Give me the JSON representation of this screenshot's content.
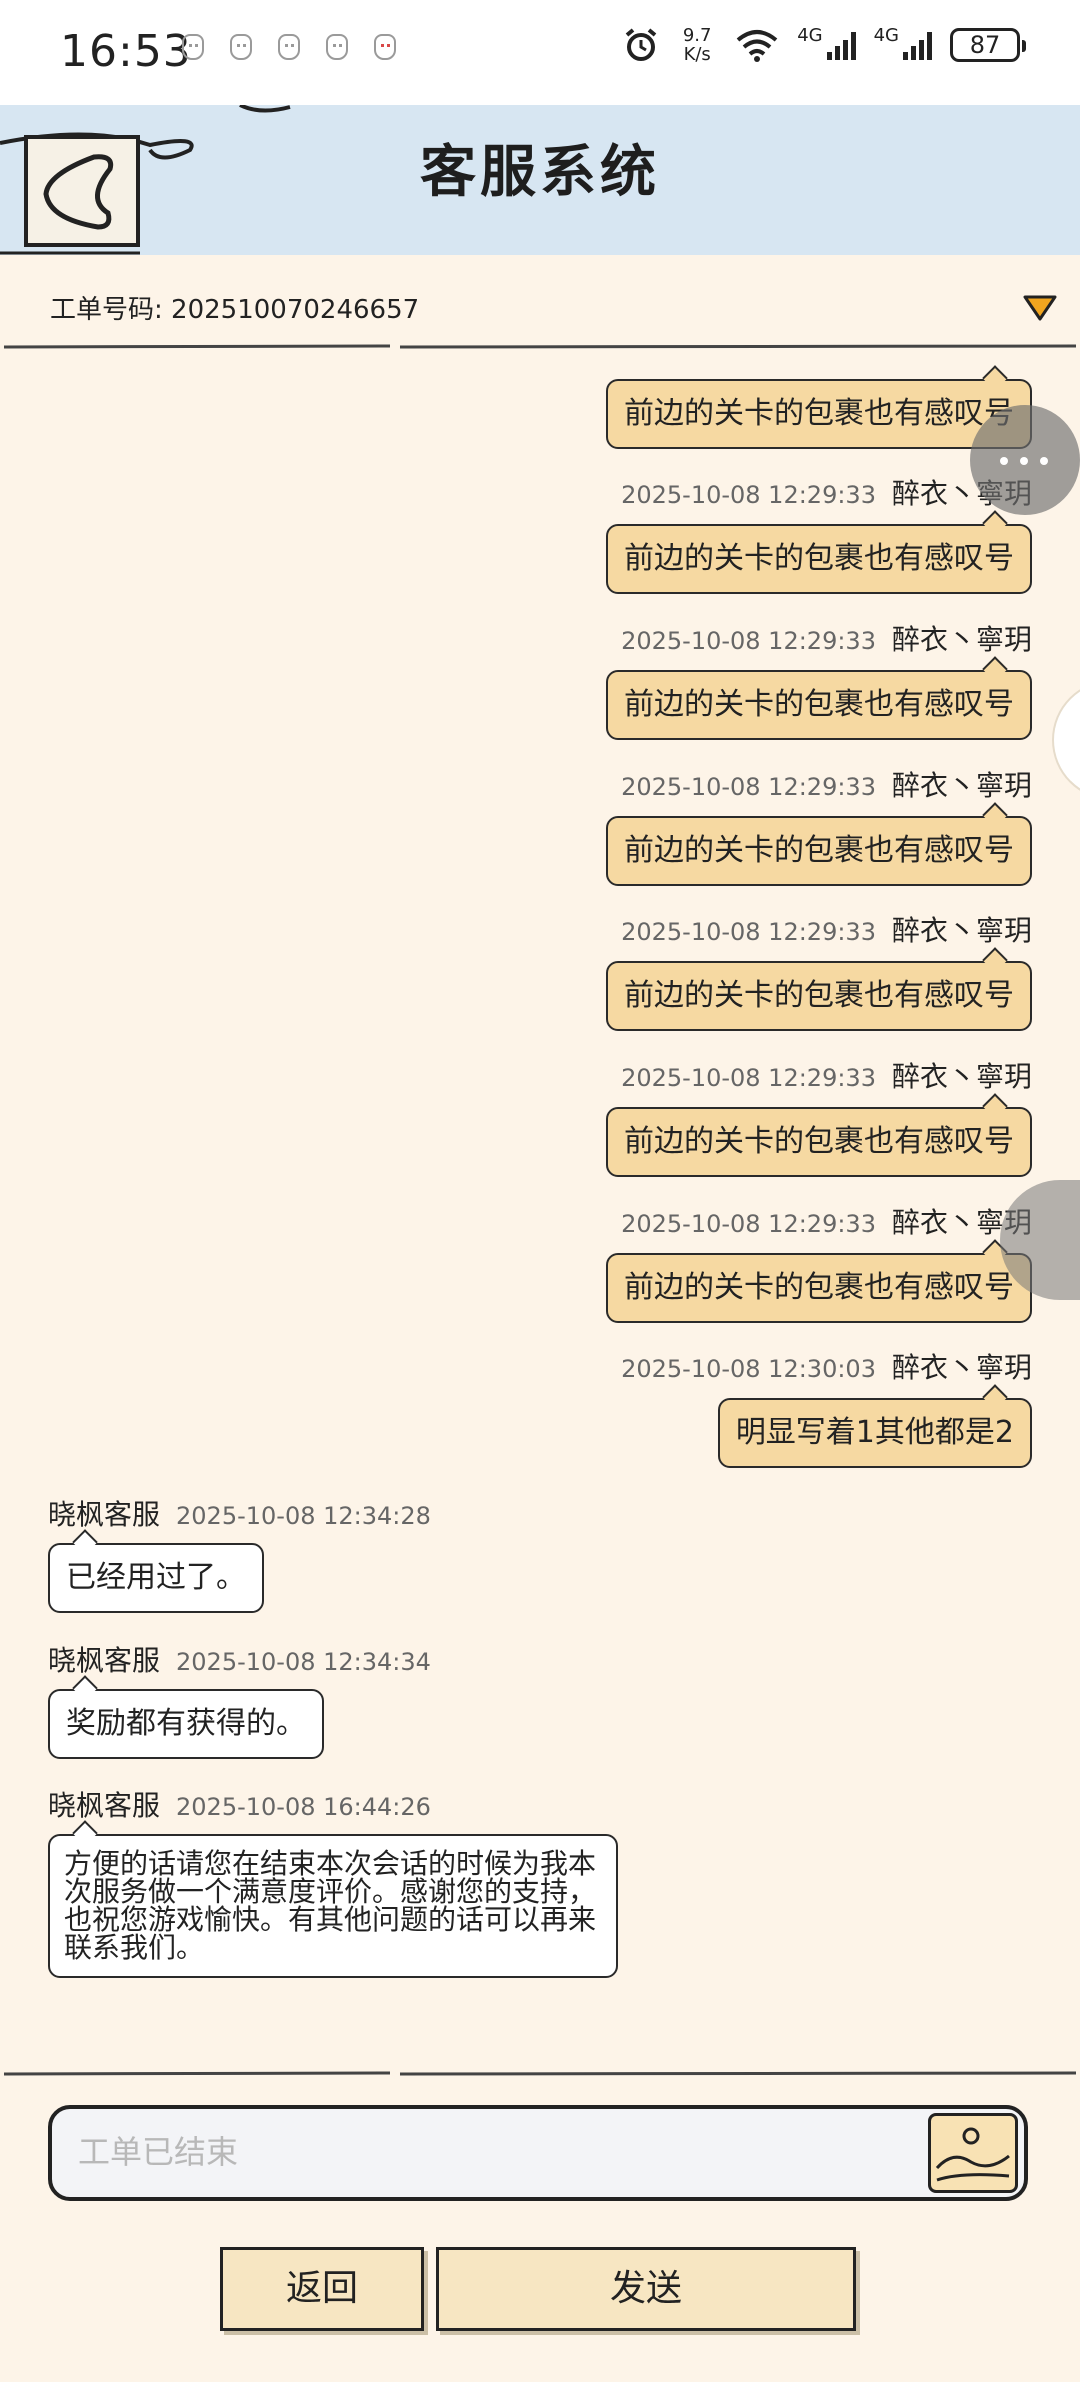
{
  "status_bar": {
    "time": "16:53",
    "net_speed_value": "9.7",
    "net_speed_unit": "K/s",
    "network_type_1": "4G",
    "network_type_2": "4G",
    "battery": "87"
  },
  "header": {
    "title": "客服系统"
  },
  "ticket": {
    "label": "工单号码:",
    "number": "202510070246657"
  },
  "messages_out": [
    {
      "text": "前边的关卡的包裹也有感叹号",
      "time": "",
      "sender": ""
    },
    {
      "text": "前边的关卡的包裹也有感叹号",
      "time": "2025-10-08 12:29:33",
      "sender": "醉衣丶寧玥"
    },
    {
      "text": "前边的关卡的包裹也有感叹号",
      "time": "2025-10-08 12:29:33",
      "sender": "醉衣丶寧玥"
    },
    {
      "text": "前边的关卡的包裹也有感叹号",
      "time": "2025-10-08 12:29:33",
      "sender": "醉衣丶寧玥"
    },
    {
      "text": "前边的关卡的包裹也有感叹号",
      "time": "2025-10-08 12:29:33",
      "sender": "醉衣丶寧玥"
    },
    {
      "text": "前边的关卡的包裹也有感叹号",
      "time": "2025-10-08 12:29:33",
      "sender": "醉衣丶寧玥"
    },
    {
      "text": "前边的关卡的包裹也有感叹号",
      "time": "2025-10-08 12:29:33",
      "sender": "醉衣丶寧玥"
    },
    {
      "text": "明显写着1其他都是2",
      "time": "2025-10-08 12:30:03",
      "sender": "醉衣丶寧玥"
    }
  ],
  "messages_in": [
    {
      "sender": "晓枫客服",
      "time": "2025-10-08 12:34:28",
      "text": "已经用过了。"
    },
    {
      "sender": "晓枫客服",
      "time": "2025-10-08 12:34:34",
      "text": "奖励都有获得的。"
    },
    {
      "sender": "晓枫客服",
      "time": "2025-10-08 16:44:26",
      "text": "方便的话请您在结束本次会话的时候为我本次服务做一个满意度评价。感谢您的支持，也祝您游戏愉快。有其他问题的话可以再来联系我们。"
    }
  ],
  "input": {
    "placeholder": "工单已结束"
  },
  "buttons": {
    "return_label": "返回",
    "send_label": "发送"
  },
  "colors": {
    "page_bg": "#fdf4e8",
    "header_bg": "#d7e6f2",
    "bubble_out": "#f6d9a2",
    "bubble_in": "#ffffff",
    "button_bg": "#f7e6c2"
  },
  "icons": [
    "alarm-icon",
    "wifi-icon",
    "signal-icon",
    "battery-icon",
    "back-arrow-icon",
    "dropdown-triangle-icon",
    "more-dots-icon",
    "image-upload-icon"
  ]
}
